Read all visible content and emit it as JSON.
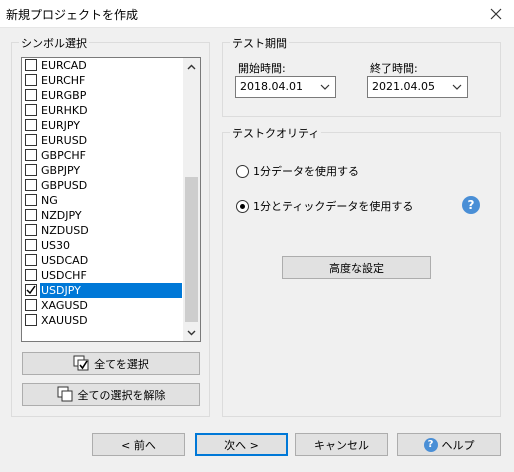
{
  "window": {
    "title": "新規プロジェクトを作成",
    "close_icon": "close-icon"
  },
  "symbols": {
    "label": "シンボル選択",
    "items": [
      {
        "name": "EURCAD",
        "checked": false,
        "selected": false
      },
      {
        "name": "EURCHF",
        "checked": false,
        "selected": false
      },
      {
        "name": "EURGBP",
        "checked": false,
        "selected": false
      },
      {
        "name": "EURHKD",
        "checked": false,
        "selected": false
      },
      {
        "name": "EURJPY",
        "checked": false,
        "selected": false
      },
      {
        "name": "EURUSD",
        "checked": false,
        "selected": false
      },
      {
        "name": "GBPCHF",
        "checked": false,
        "selected": false
      },
      {
        "name": "GBPJPY",
        "checked": false,
        "selected": false
      },
      {
        "name": "GBPUSD",
        "checked": false,
        "selected": false
      },
      {
        "name": "NG",
        "checked": false,
        "selected": false
      },
      {
        "name": "NZDJPY",
        "checked": false,
        "selected": false
      },
      {
        "name": "NZDUSD",
        "checked": false,
        "selected": false
      },
      {
        "name": "US30",
        "checked": false,
        "selected": false
      },
      {
        "name": "USDCAD",
        "checked": false,
        "selected": false
      },
      {
        "name": "USDCHF",
        "checked": false,
        "selected": false
      },
      {
        "name": "USDJPY",
        "checked": true,
        "selected": true
      },
      {
        "name": "XAGUSD",
        "checked": false,
        "selected": false
      },
      {
        "name": "XAUUSD",
        "checked": false,
        "selected": false
      }
    ],
    "select_all_label": "全てを選択",
    "deselect_all_label": "全ての選択を解除"
  },
  "test_period": {
    "label": "テスト期間",
    "start_label": "開始時間:",
    "start_value": "2018.04.01",
    "end_label": "終了時間:",
    "end_value": "2021.04.05"
  },
  "test_quality": {
    "label": "テストクオリティ",
    "option1": "1分データを使用する",
    "option2": "1分とティックデータを使用する",
    "selected_option": 2,
    "advanced_label": "高度な設定"
  },
  "footer": {
    "back_label": "< 前へ",
    "next_label": "次へ >",
    "cancel_label": "キャンセル",
    "help_label": "ヘルプ"
  },
  "colors": {
    "selection": "#0078d7",
    "help_icon": "#4a8fd6"
  }
}
